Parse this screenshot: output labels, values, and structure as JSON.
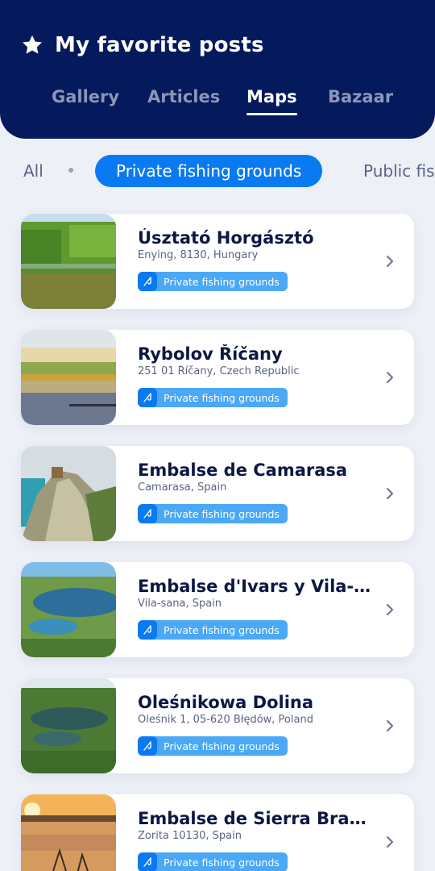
{
  "header": {
    "title": "My favorite posts",
    "tabs": [
      {
        "label": "Gallery"
      },
      {
        "label": "Articles"
      },
      {
        "label": "Maps"
      },
      {
        "label": "Bazaar"
      }
    ],
    "active_tab": "Maps"
  },
  "filters": {
    "items": [
      {
        "label": "All"
      },
      {
        "label": "Private fishing grounds"
      },
      {
        "label": "Public fishing grounds"
      }
    ],
    "active": "Private fishing grounds"
  },
  "places": [
    {
      "name": "Úsztató Horgásztó",
      "address": "Enying, 8130, Hungary",
      "tag": "Private fishing grounds"
    },
    {
      "name": "Rybolov Říčany",
      "address": "251 01 Říčany, Czech Republic",
      "tag": "Private fishing grounds"
    },
    {
      "name": "Embalse de Camarasa",
      "address": "Camarasa, Spain",
      "tag": "Private fishing grounds"
    },
    {
      "name": "Embalse d'Ivars y Vila-sana",
      "address": "Vila-sana, Spain",
      "tag": "Private fishing grounds"
    },
    {
      "name": "Oleśnikowa Dolina",
      "address": "Oleśnik 1, 05-620 Błędów, Poland",
      "tag": "Private fishing grounds"
    },
    {
      "name": "Embalse de Sierra Brava",
      "address": "Zorita 10130, Spain",
      "tag": "Private fishing grounds"
    }
  ],
  "colors": {
    "header_bg": "#041a5c",
    "accent": "#0a7af2",
    "tag_bg": "#4aa8f5",
    "page_bg": "#eef0f8"
  }
}
